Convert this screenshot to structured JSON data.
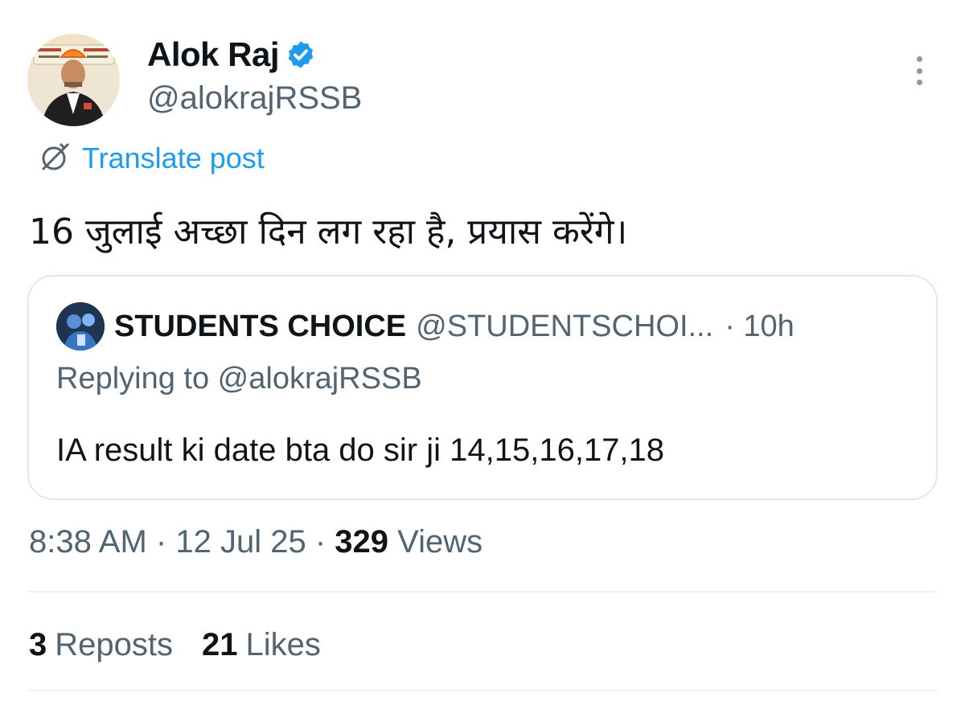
{
  "author": {
    "display_name": "Alok Raj",
    "handle": "@alokrajRSSB",
    "avatar_icon": "profile-photo"
  },
  "translate_label": "Translate post",
  "post_text": "16 जुलाई अच्छा दिन लग रहा है,  प्रयास करेंगे।",
  "quoted": {
    "display_name": "STUDENTS CHOICE",
    "handle": "@STUDENTSCHOI...",
    "time": "· 10h",
    "replying_to": "Replying to @alokrajRSSB",
    "text": "IA result ki date bta do sir ji 14,15,16,17,18"
  },
  "meta": {
    "time": "8:38 AM",
    "sep1": "·",
    "date": "12 Jul 25",
    "sep2": "·",
    "views_count": "329",
    "views_label": "Views"
  },
  "stats": {
    "reposts_count": "3",
    "reposts_label": "Reposts",
    "likes_count": "21",
    "likes_label": "Likes"
  },
  "colors": {
    "accent": "#1d9bf0",
    "secondary_text": "#536471",
    "primary_text": "#0f1419"
  }
}
